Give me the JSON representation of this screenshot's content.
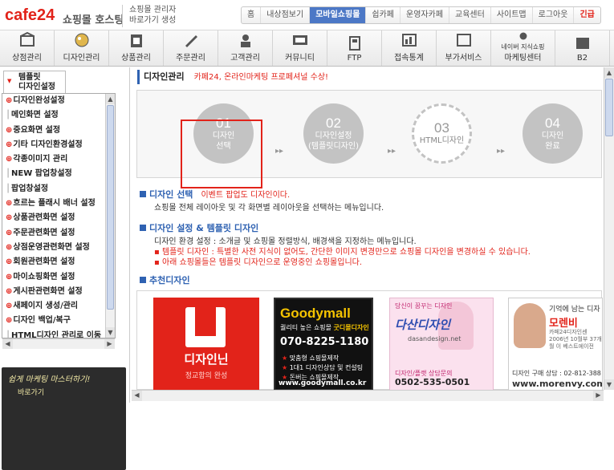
{
  "header": {
    "logo_main": "cafe",
    "logo_num": "24",
    "logo_sub": "쇼핑몰 호스팅",
    "shortcut_line1": "쇼핑몰 관리자",
    "shortcut_line2": "바로가기 생성",
    "topnav": [
      "홈",
      "내상점보기",
      "모바일쇼핑몰",
      "쉽카페",
      "운영자카페",
      "교육센터",
      "사이트맵",
      "로그아웃",
      "긴급"
    ]
  },
  "mainnav": [
    {
      "label": "상점관리",
      "icon": "store-icon"
    },
    {
      "label": "디자인관리",
      "icon": "design-icon"
    },
    {
      "label": "상품관리",
      "icon": "product-icon"
    },
    {
      "label": "주문관리",
      "icon": "order-icon"
    },
    {
      "label": "고객관리",
      "icon": "customer-icon"
    },
    {
      "label": "커뮤니티",
      "icon": "community-icon"
    },
    {
      "label": "FTP",
      "icon": "ftp-icon"
    },
    {
      "label": "접속통계",
      "icon": "stats-icon"
    },
    {
      "label": "부가서비스",
      "icon": "addon-icon"
    },
    {
      "label": "마케팅센터",
      "sub": "네이버 지식쇼핑",
      "icon": "marketing-icon"
    },
    {
      "label": "B2",
      "icon": "b2b-icon"
    }
  ],
  "sidebar": {
    "tab_line1": "템플릿",
    "tab_line2": "디자인설정",
    "items": [
      {
        "label": "디자인완성설정",
        "exp": true
      },
      {
        "label": "메인화면 설정",
        "exp": false
      },
      {
        "label": "중요화면 설정",
        "exp": true
      },
      {
        "label": "기타 디자인환경설정",
        "exp": true
      },
      {
        "label": "각종이미지 관리",
        "exp": true
      },
      {
        "label": "NEW 팝업창설정",
        "exp": false
      },
      {
        "label": "팝업창설정",
        "exp": false
      },
      {
        "label": "흐르는 플래시 배너 설정",
        "exp": true
      },
      {
        "label": "상품관련화면 설정",
        "exp": true
      },
      {
        "label": "주문관련화면 설정",
        "exp": true
      },
      {
        "label": "상점운영관련화면 설정",
        "exp": true
      },
      {
        "label": "회원관련화면 설정",
        "exp": true
      },
      {
        "label": "마이쇼핑화면 설정",
        "exp": true
      },
      {
        "label": "게시판관련화면 설정",
        "exp": true
      },
      {
        "label": "새페이지 생성/관리",
        "exp": true
      },
      {
        "label": "디자인 백업/복구",
        "exp": true
      },
      {
        "label": "HTML디자인 관리로 이동",
        "exp": false
      }
    ],
    "ad_title": "쉽게 마케팅 마스터하기!",
    "ad_sub": "바로가기"
  },
  "content": {
    "title": "디자인관리",
    "title_sub": "카페24, 온라인마케팅 프로페셔널 수상!",
    "steps": [
      {
        "num": "01",
        "l1": "디자인",
        "l2": "선택"
      },
      {
        "num": "02",
        "l1": "디자인설정",
        "l2": "(템플릿디자인)"
      },
      {
        "num": "03",
        "l1": "HTML디자인",
        "l2": ""
      },
      {
        "num": "04",
        "l1": "디자인",
        "l2": "완료"
      }
    ],
    "sec1_title": "디자인 선택",
    "sec1_note": "이벤트 팝업도 디자인이다.",
    "sec1_body": "쇼핑몰 전체 레이아웃 및 각 화면별 레이아웃을 선택하는 메뉴입니다.",
    "sec2_title": "디자인 설정 & 템플릿 디자인",
    "sec2_body1": "디자인 환경 설정 : 소개글 및 쇼핑몰 정렬방식, 배경색을 지정하는 메뉴입니다.",
    "sec2_body2": "▪ 템플릿 디자인 : 특별한 사전 지식이 없어도, 간단한 이미지 변경만으로 쇼핑몰 디자인을 변경하실 수 있습니다.",
    "sec2_body3": "▪ 아래 쇼핑몰들은 템플릿 디자인으로 운영중인 쇼핑몰입니다.",
    "sec3_title": "추천디자인"
  },
  "cards": {
    "c1_title": "디자인닌",
    "c1_sub": "정교함의 완성",
    "c2_brand": "Goodymall",
    "c2_sub_pre": "퀄리티 높은 쇼핑몰",
    "c2_sub_hl": "굿디몰디자인",
    "c2_phone": "070-8225-1180",
    "c2_bullets": [
      "맞춤형 쇼핑몰제작",
      "1대1 디자인상담 및 컨설팅",
      "돈버는 쇼핑몰제작"
    ],
    "c2_url": "www.goodymall.co.kr",
    "c3_q": "당신이 꿈꾸는 디자인",
    "c3_brand": "다산디자인",
    "c3_url": "dasandesign.net",
    "c3_consult": "디자인/플랫 상담문의",
    "c3_phone": "0502-535-0501",
    "c4_l1": "기억에 남는 디자",
    "c4_l2": "모렌비",
    "c4_l3": "카페24디자인센 2006년 10월부 37개월 이 베스트에이전",
    "c4_l4": "디자인 구매 상담 : 02-812-388",
    "c4_l5": "www.morenvy.com"
  }
}
